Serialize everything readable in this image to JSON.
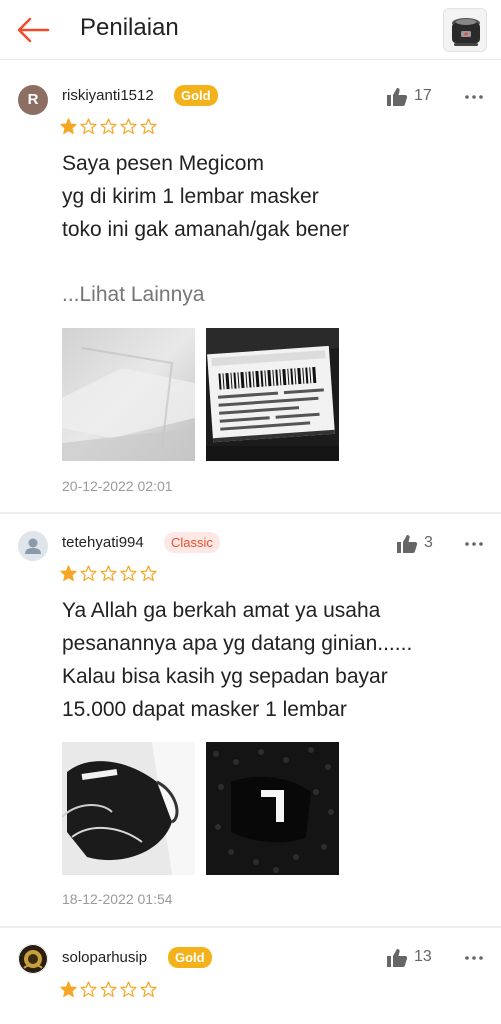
{
  "header": {
    "title": "Penilaian",
    "back_icon": "arrow-left-icon",
    "accent": "#ee4d2d"
  },
  "colors": {
    "star": "#f5a623",
    "gold_badge": "#f3b21b",
    "classic_badge_text": "#ee4d2d",
    "classic_badge_bg": "#fde8e5",
    "secondary_text": "#757575",
    "date_text": "#9a9a9a"
  },
  "reviews": [
    {
      "avatar_letter": "R",
      "username": "riskiyanti1512",
      "badge": "Gold",
      "likes": "17",
      "rating": 1,
      "max_rating": 5,
      "text_lines": [
        "Saya pesen Megicom",
        "yg di kirim 1 lembar masker",
        "toko ini gak amanah/gak bener"
      ],
      "see_more": "...Lihat Lainnya",
      "photo_count": 2,
      "date": "20-12-2022 02:01"
    },
    {
      "username": "tetehyati994",
      "badge": "Classic",
      "likes": "3",
      "rating": 1,
      "max_rating": 5,
      "text_lines": [
        "Ya Allah ga berkah amat ya usaha",
        "pesanannya apa yg datang ginian......",
        "Kalau bisa kasih yg sepadan bayar",
        "15.000 dapat masker 1 lembar"
      ],
      "photo_count": 2,
      "date": "18-12-2022 01:54"
    },
    {
      "username": "soloparhusip",
      "badge": "Gold",
      "likes": "13",
      "rating": 1,
      "max_rating": 5
    }
  ]
}
